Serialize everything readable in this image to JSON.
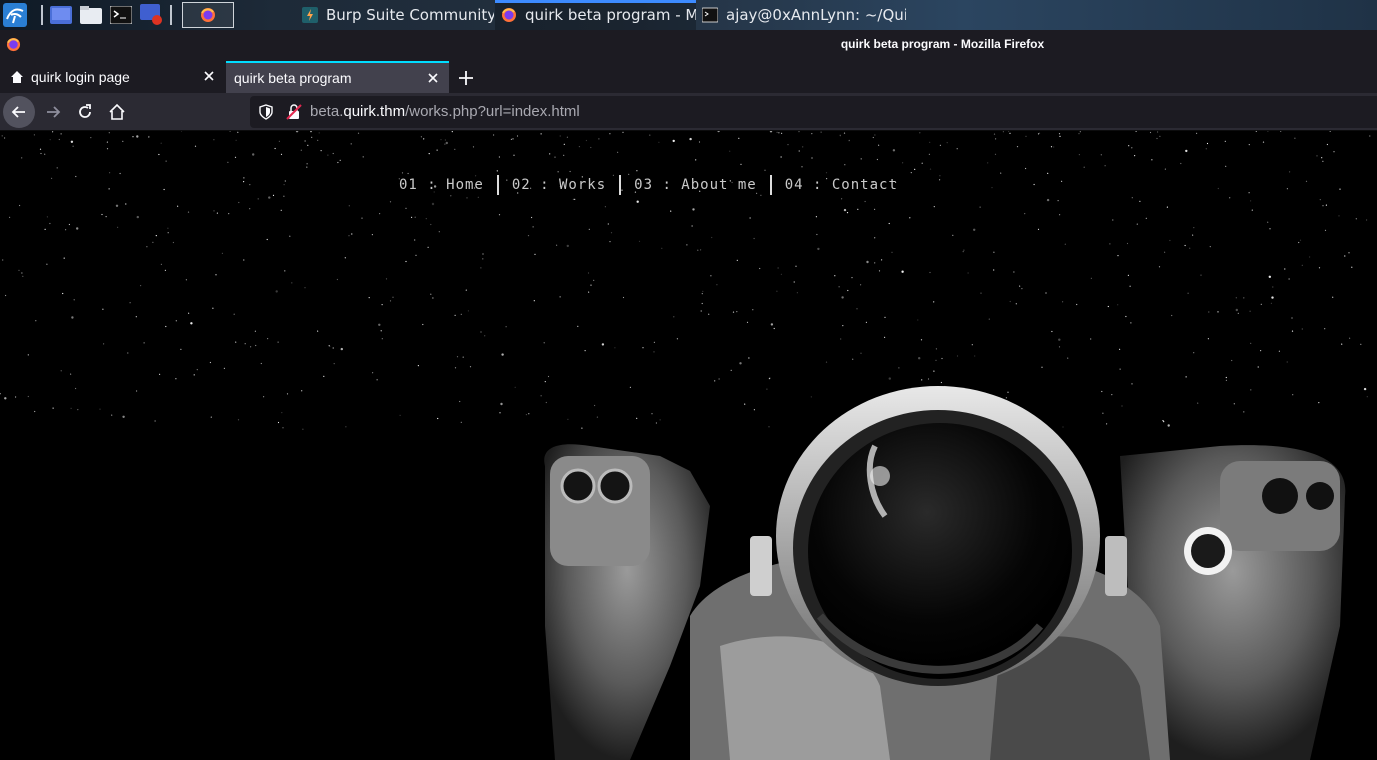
{
  "taskbar": {
    "tasks": [
      {
        "label": "Burp Suite Community E..."
      },
      {
        "label": "quirk beta program - Mo..."
      },
      {
        "label": "ajay@0xAnnLynn: ~/Qui..."
      }
    ]
  },
  "window": {
    "title": "quirk beta program - Mozilla Firefox"
  },
  "tabs": [
    {
      "label": "quirk login page"
    },
    {
      "label": "quirk beta program"
    }
  ],
  "urlbar": {
    "prefix": "beta.",
    "host": "quirk.thm",
    "path": "/works.php?url=index.html"
  },
  "site": {
    "menu": [
      {
        "label": "01 : Home"
      },
      {
        "label": "02 : Works"
      },
      {
        "label": "03 : About me"
      },
      {
        "label": "04 : Contact"
      }
    ]
  },
  "colors": {
    "tab_accent": "#00ddff",
    "task_accent": "#3d8bff",
    "page_bg": "#000000"
  },
  "icons": [
    "kali-menu-icon",
    "desktop-icon",
    "file-manager-icon",
    "terminal-icon",
    "screen-recorder-icon",
    "firefox-icon",
    "burp-icon",
    "back-arrow-icon",
    "forward-arrow-icon",
    "reload-icon",
    "home-icon",
    "shield-icon",
    "insecure-lock-icon",
    "close-icon",
    "plus-icon"
  ]
}
